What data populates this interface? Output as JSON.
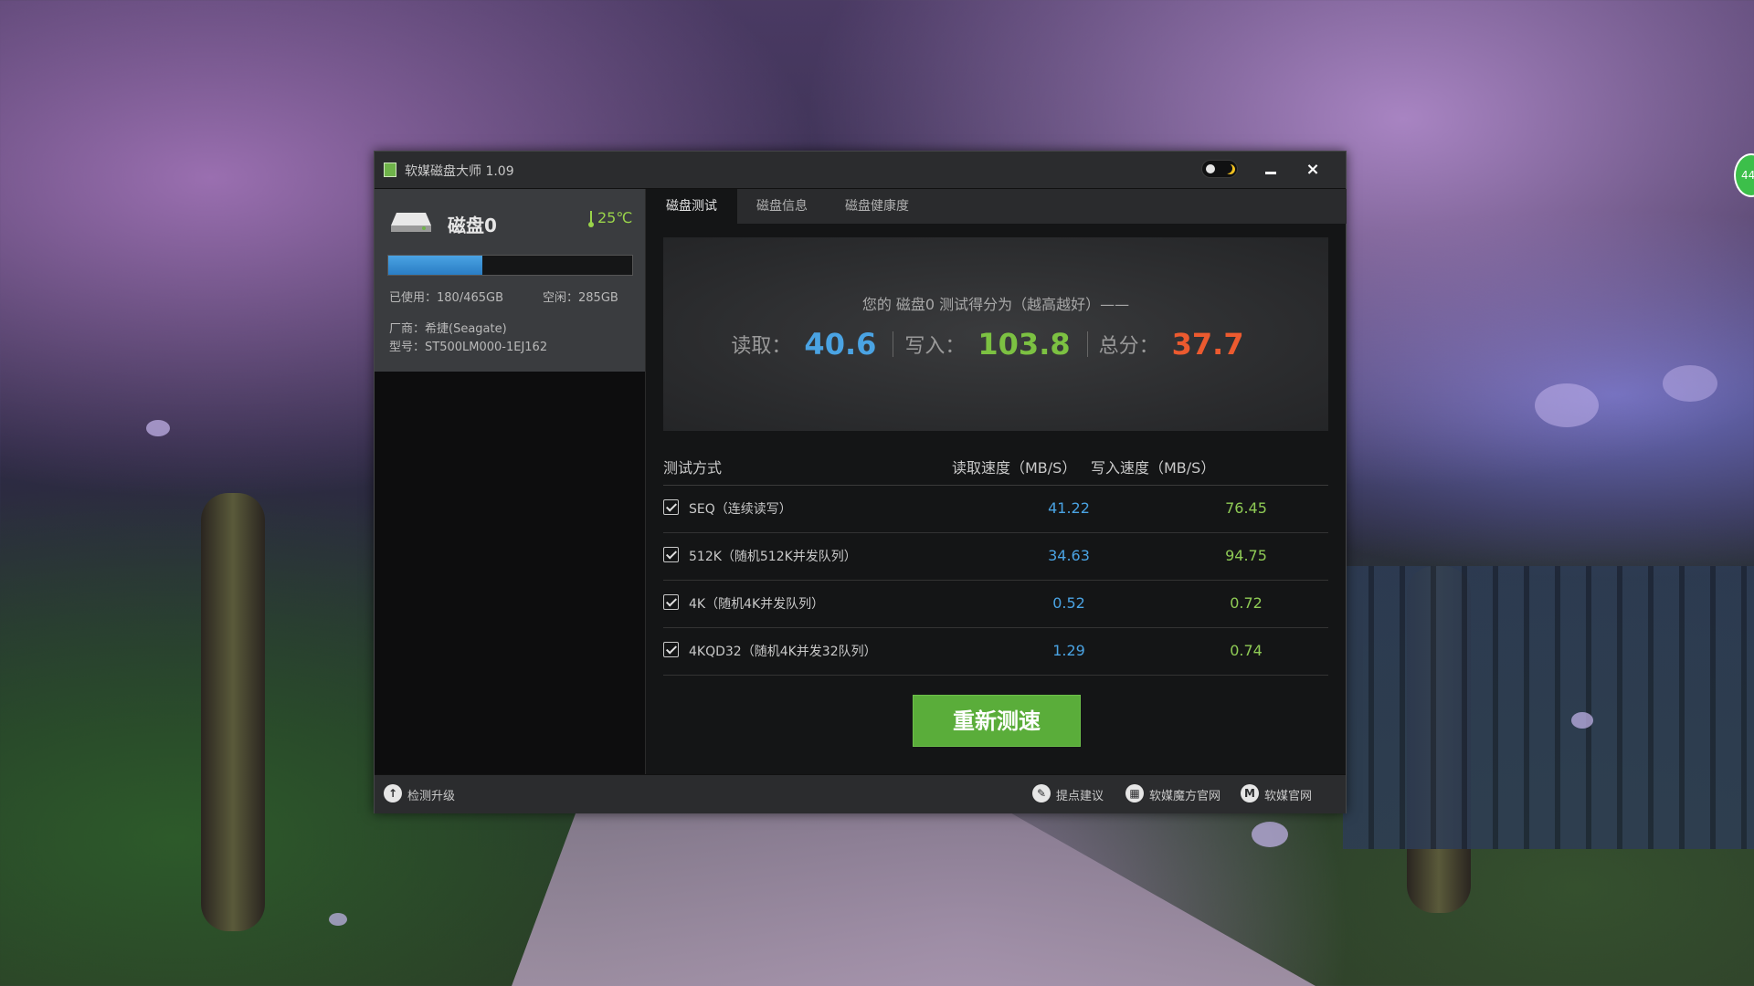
{
  "desktop": {
    "badge": "44"
  },
  "window": {
    "title": "软媒磁盘大师 1.09",
    "close_glyph": "×"
  },
  "disk": {
    "name": "磁盘0",
    "temperature": "25℃",
    "used_label": "已使用：180/465GB",
    "free_label": "空闲：285GB",
    "used_fraction": 0.387,
    "vendor": "厂商：希捷(Seagate)",
    "model": "型号：ST500LM000-1EJ162"
  },
  "tabs": [
    {
      "label": "磁盘测试",
      "active": true
    },
    {
      "label": "磁盘信息",
      "active": false
    },
    {
      "label": "磁盘健康度",
      "active": false
    }
  ],
  "score": {
    "caption": "您的 磁盘0 测试得分为（越高越好）——",
    "read_label": "读取：",
    "read_value": "40.6",
    "write_label": "写入：",
    "write_value": "103.8",
    "total_label": "总分：",
    "total_value": "37.7"
  },
  "table": {
    "headers": {
      "method": "测试方式",
      "read": "读取速度（MB/S）",
      "write": "写入速度（MB/S）"
    },
    "rows": [
      {
        "method": "SEQ（连续读写）",
        "read": "41.22",
        "write": "76.45",
        "checked": true
      },
      {
        "method": "512K（随机512K并发队列）",
        "read": "34.63",
        "write": "94.75",
        "checked": true
      },
      {
        "method": "4K（随机4K并发队列）",
        "read": "0.52",
        "write": "0.72",
        "checked": true
      },
      {
        "method": "4KQD32（随机4K并发32队列）",
        "read": "1.29",
        "write": "0.74",
        "checked": true
      }
    ]
  },
  "retest_label": "重新测速",
  "footer": {
    "upgrade": "检测升级",
    "suggest": "提点建议",
    "cube_site": "软媒魔方官网",
    "official_site": "软媒官网"
  },
  "colors": {
    "read": "#4aa3e3",
    "write": "#7cc142",
    "total": "#ec5a2f",
    "accent_button": "#5aad3a"
  }
}
